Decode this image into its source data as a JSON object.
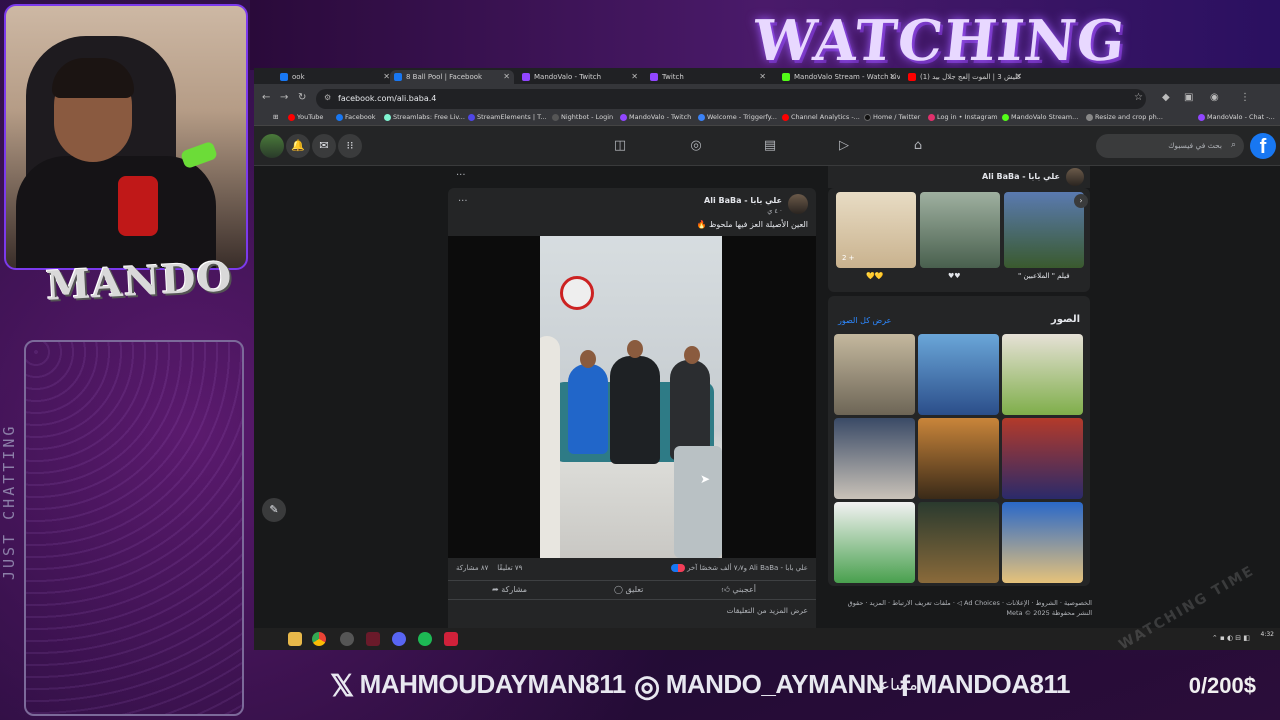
{
  "overlay": {
    "title": "WATCHING TIME",
    "logo": "MANDO",
    "category": "JUST CHATTING",
    "watermark": "WATCHING TIME",
    "socials": {
      "x_handle": "MAHMOUDAYMAN811",
      "instagram_handle": "MANDO_AYMANN",
      "arabic_tag": "مساعد",
      "facebook_handle": "MANDOA811"
    },
    "donation_goal": "0/200$"
  },
  "browser": {
    "tabs": [
      {
        "label": "ook",
        "color": "#1877f2"
      },
      {
        "label": "8 Ball Pool | Facebook",
        "color": "#1877f2"
      },
      {
        "label": "MandoValo - Twitch",
        "color": "#9146ff"
      },
      {
        "label": "Twitch",
        "color": "#9146ff"
      },
      {
        "label": "MandoValo Stream - Watch Live",
        "color": "#53fc18"
      },
      {
        "label": "(1) كليش 3 | الموت إلعج جلال بيد",
        "color": "#ff0000"
      }
    ],
    "url": "facebook.com/ali.baba.4",
    "bookmarks": [
      {
        "label": "YouTube",
        "color": "#ff0000"
      },
      {
        "label": "Facebook",
        "color": "#1877f2"
      },
      {
        "label": "Streamlabs: Free Liv...",
        "color": "#80f5d2"
      },
      {
        "label": "StreamElements | T...",
        "color": "#4f46e5"
      },
      {
        "label": "Nightbot - Login",
        "color": "#333"
      },
      {
        "label": "MandoValo - Twitch",
        "color": "#9146ff"
      },
      {
        "label": "Welcome - Triggerfy...",
        "color": "#3b82f6"
      },
      {
        "label": "Channel Analytics -...",
        "color": "#ff0000"
      },
      {
        "label": "Home / Twitter",
        "color": "#111"
      },
      {
        "label": "Log in • Instagram",
        "color": "#e1306c"
      },
      {
        "label": "MandoValo Stream...",
        "color": "#53fc18"
      },
      {
        "label": "Resize and crop ph...",
        "color": "#888"
      },
      {
        "label": "MandoValo - Chat -...",
        "color": "#9146ff"
      }
    ]
  },
  "facebook": {
    "search_placeholder": "بحث في فيسبوك",
    "profile_name": "علي بابا - Ali BaBa",
    "post": {
      "author": "علي بابا - Ali BaBa",
      "time": "٤ ي · ",
      "caption": "العين الأصيلة العز فيها ملحوظ 🔥",
      "reactions_text": "علي بابا - Ali BaBa و٧٫٧ ألف شخصًا آخر",
      "comments_count": "٧٩ تعليقًا",
      "shares_count": "٨٧ مشاركة",
      "like_label": "أعجبني",
      "comment_label": "تعليق",
      "share_label": "مشاركة",
      "more_comments": "عرض المزيد من التعليقات"
    },
    "featured": [
      {
        "label": "فيلم \" الملاعبين \"",
        "badge": ""
      },
      {
        "label": "♥♥",
        "badge": ""
      },
      {
        "label": "💛💛",
        "badge": "2 +"
      }
    ],
    "photos_title": "الصور",
    "photos_link": "عرض كل الصور",
    "footer_links": "الخصوصية · الشروط · الإعلانات · Ad Choices ◁ · ملفات تعريف الارتباط · المزيد · حقوق النشر محفوظة Meta © 2025"
  },
  "taskbar": {
    "clock": "4:32"
  }
}
